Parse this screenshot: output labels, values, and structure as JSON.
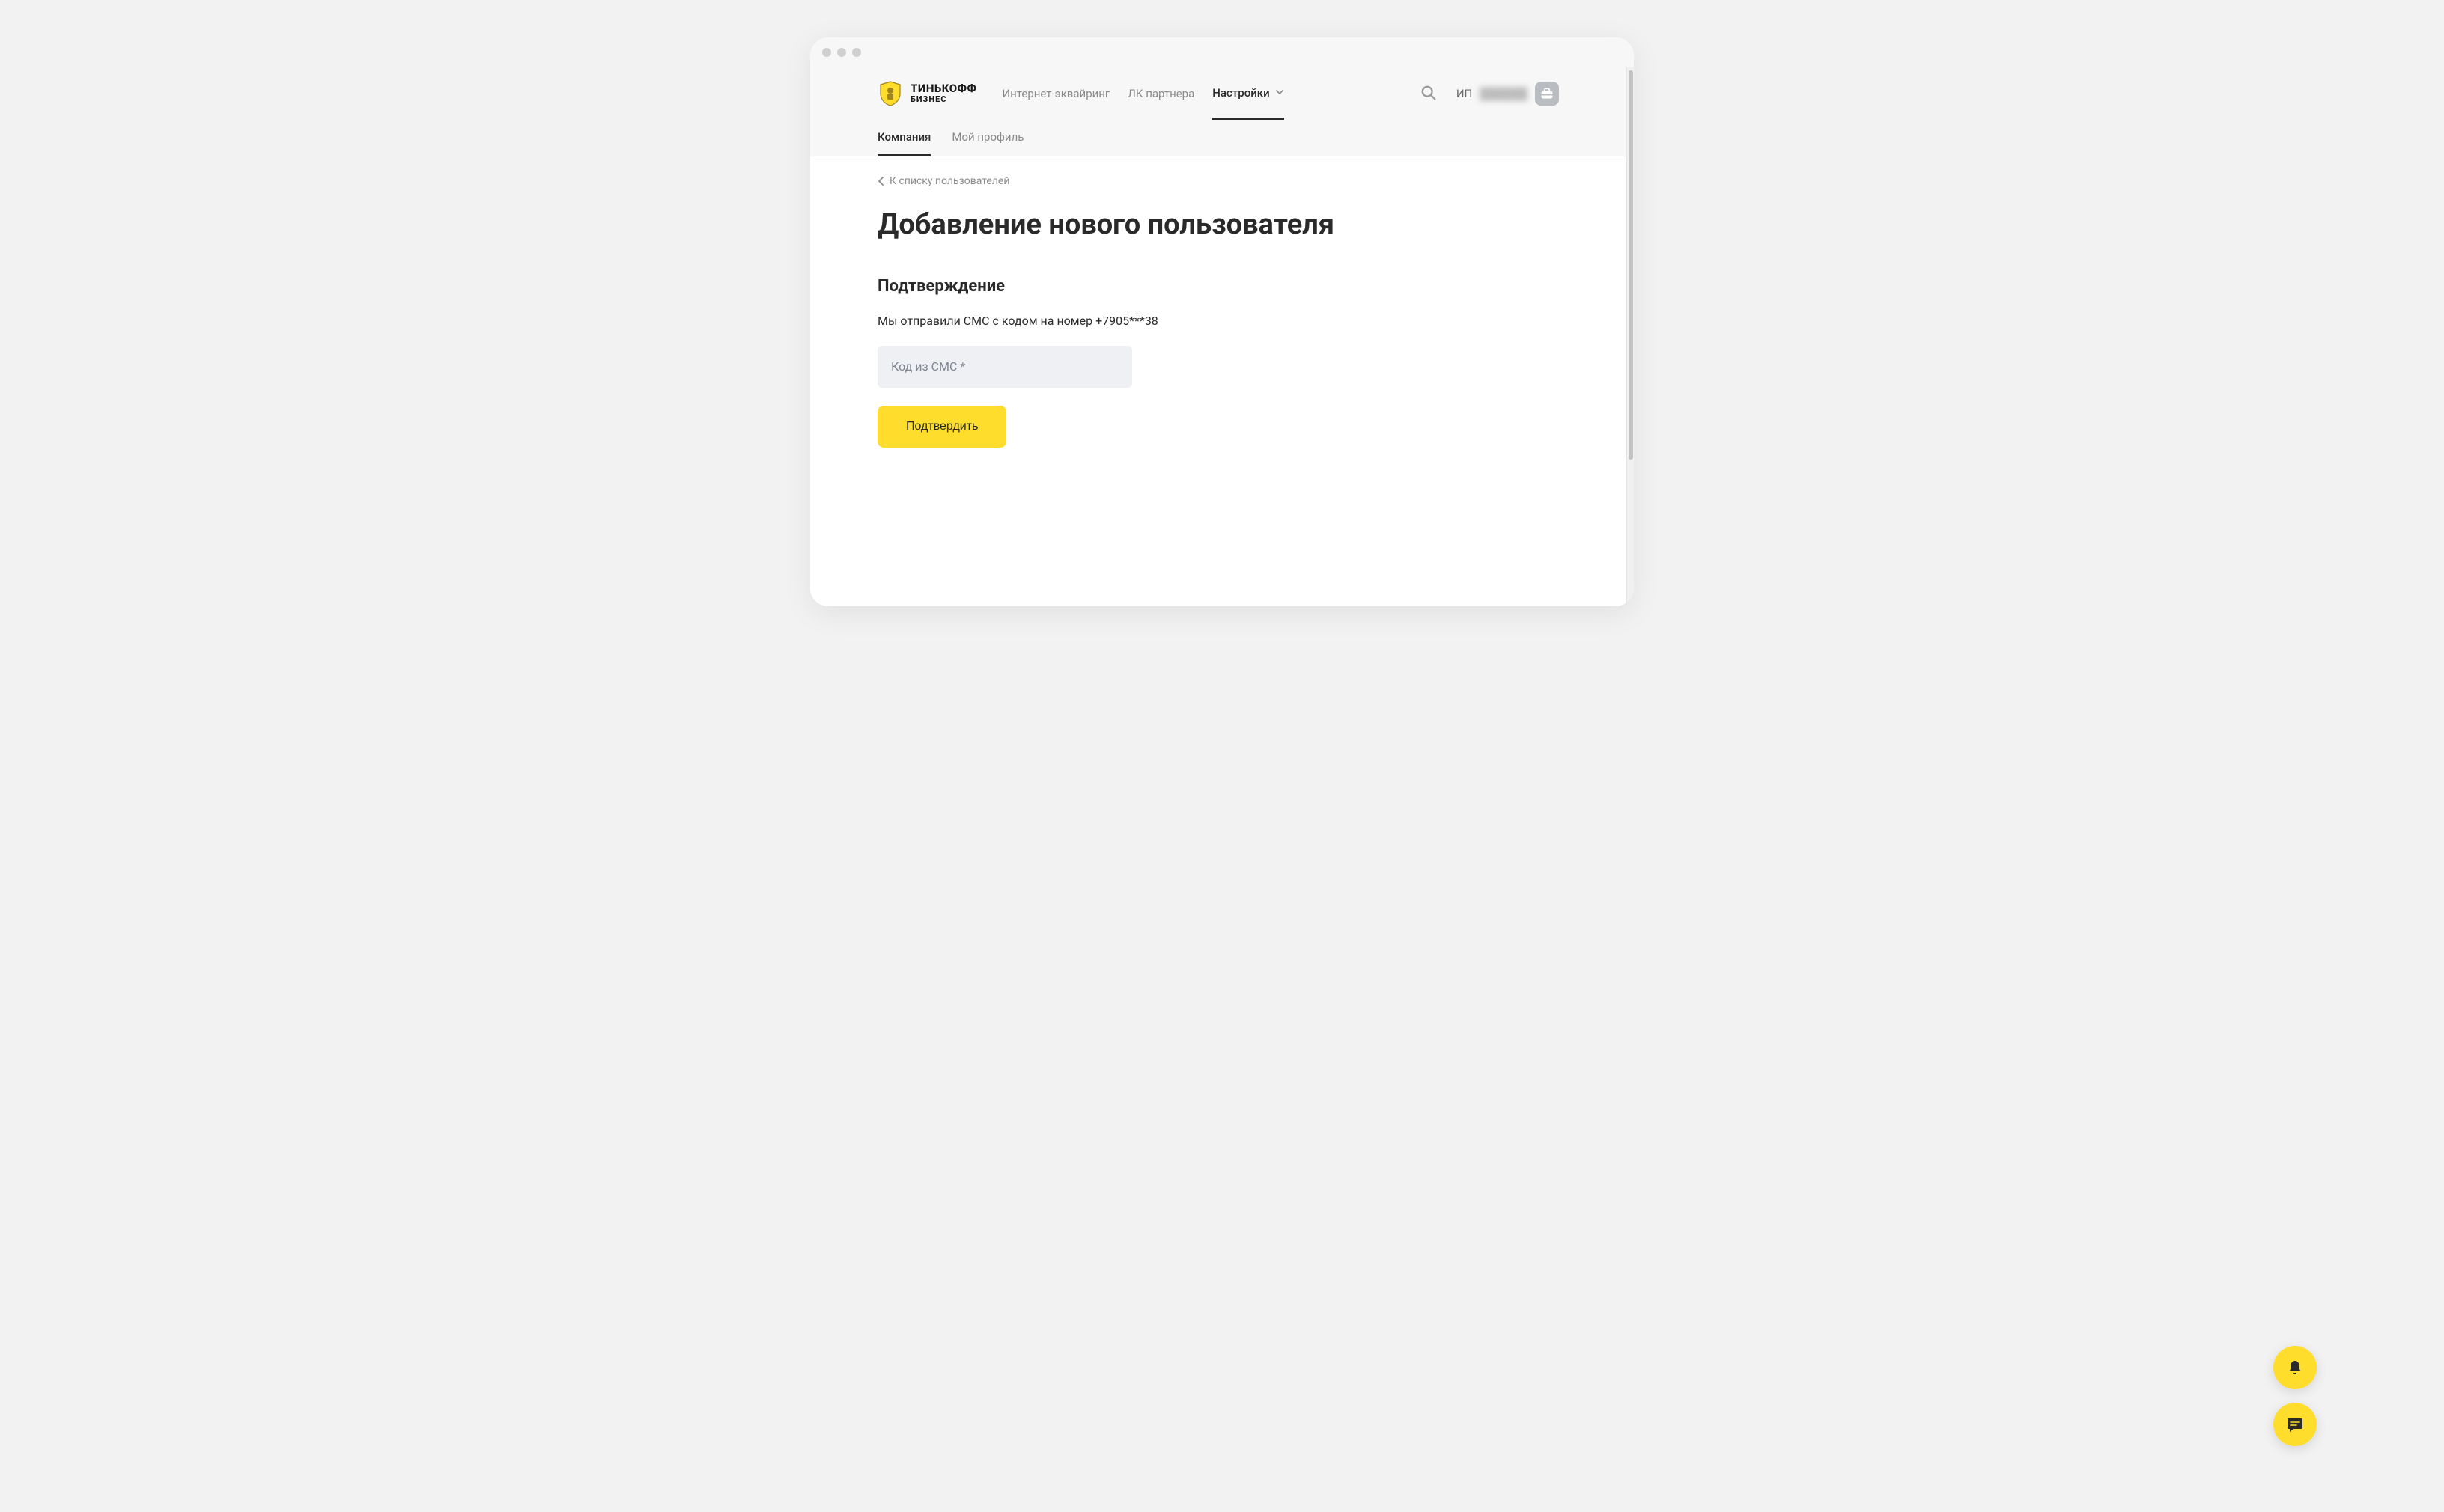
{
  "logo": {
    "line1": "ТИНЬКОФФ",
    "line2": "БИЗНЕС"
  },
  "nav": {
    "items": [
      {
        "label": "Интернет-эквайринг",
        "active": false,
        "hasDropdown": false
      },
      {
        "label": "ЛК партнера",
        "active": false,
        "hasDropdown": false
      },
      {
        "label": "Настройки",
        "active": true,
        "hasDropdown": true
      }
    ]
  },
  "account": {
    "prefix": "ИП",
    "hidden_name": "██████"
  },
  "subnav": {
    "items": [
      {
        "label": "Компания",
        "active": true
      },
      {
        "label": "Мой профиль",
        "active": false
      }
    ]
  },
  "back_link": "К списку пользователей",
  "page_title": "Добавление нового пользователя",
  "section_title": "Подтверждение",
  "info_text": "Мы отправили СМС с кодом на номер +7905***38",
  "sms_placeholder": "Код из СМС *",
  "confirm_label": "Подтвердить",
  "colors": {
    "accent_yellow": "#ffdd2d",
    "text_dark": "#2a2a2a",
    "text_muted": "#8a8a8a"
  }
}
